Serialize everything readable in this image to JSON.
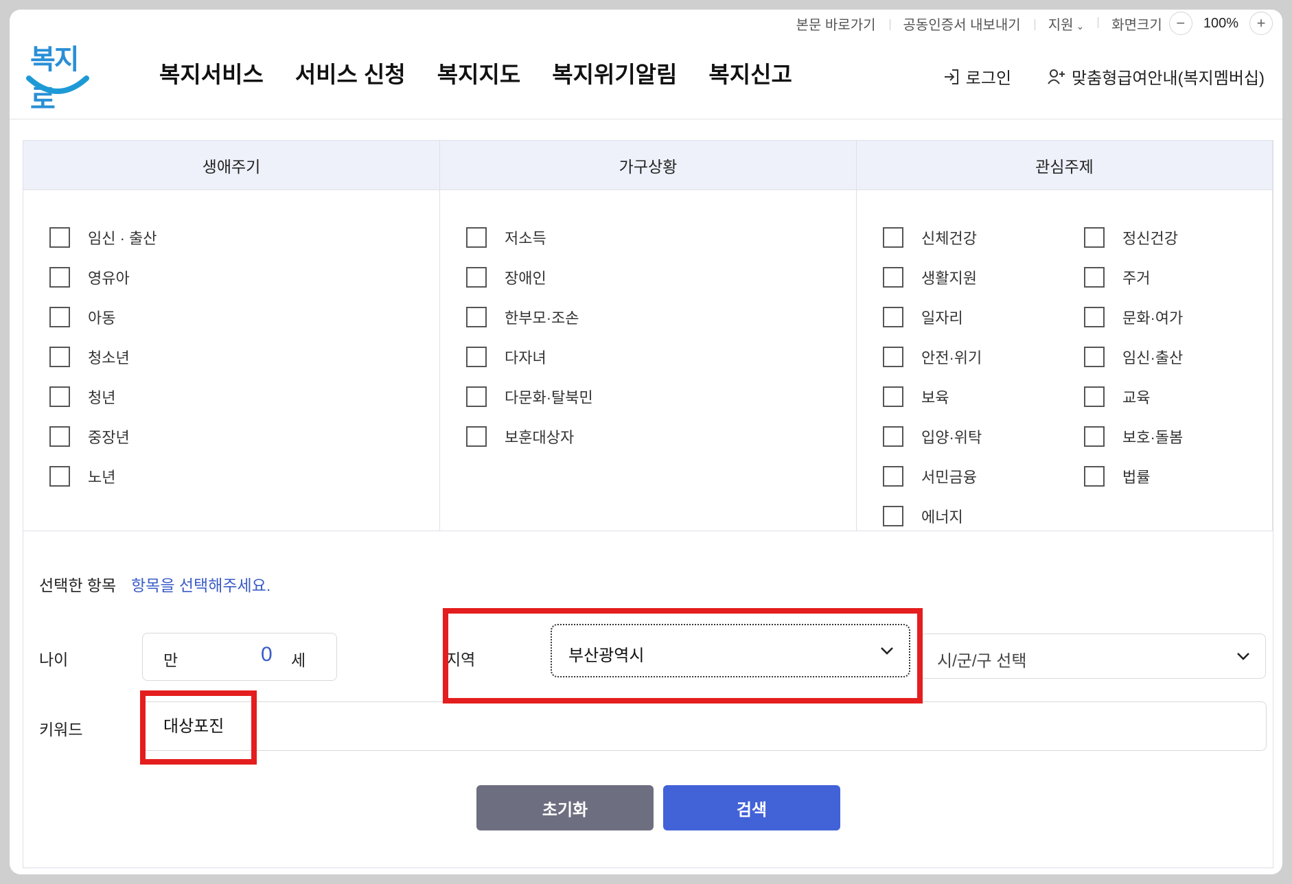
{
  "utility": {
    "skip": "본문 바로가기",
    "cert": "공동인증서 내보내기",
    "support": "지원",
    "screen_size": "화면크기",
    "zoom_value": "100%",
    "zoom_out": "−",
    "zoom_in": "+"
  },
  "logo": {
    "text": "복지로"
  },
  "nav": [
    "복지서비스",
    "서비스 신청",
    "복지지도",
    "복지위기알림",
    "복지신고"
  ],
  "header_right": {
    "login": "로그인",
    "membership": "맞춤형급여안내(복지멤버십)"
  },
  "categories": {
    "lifecycle": {
      "title": "생애주기",
      "items": [
        "임신 · 출산",
        "영유아",
        "아동",
        "청소년",
        "청년",
        "중장년",
        "노년"
      ]
    },
    "household": {
      "title": "가구상황",
      "items": [
        "저소득",
        "장애인",
        "한부모·조손",
        "다자녀",
        "다문화·탈북민",
        "보훈대상자"
      ]
    },
    "interest": {
      "title": "관심주제",
      "left": [
        "신체건강",
        "생활지원",
        "일자리",
        "안전·위기",
        "보육",
        "입양·위탁",
        "서민금융",
        "에너지"
      ],
      "right": [
        "정신건강",
        "주거",
        "문화·여가",
        "임신·출산",
        "교육",
        "보호·돌봄",
        "법률"
      ]
    }
  },
  "form": {
    "selected_label": "선택한 항목",
    "selected_hint": "항목을 선택해주세요.",
    "age_label": "나이",
    "age_prefix": "만",
    "age_value": "0",
    "age_suffix": "세",
    "region_label": "지역",
    "region_value": "부산광역시",
    "sigungu_value": "시/군/구 선택",
    "keyword_label": "키워드",
    "keyword_value": "대상포진"
  },
  "buttons": {
    "reset": "초기화",
    "search": "검색"
  },
  "colors": {
    "accent": "#4262d8",
    "highlight": "#e41e1e",
    "header_bg": "#eef1fa",
    "reset_bg": "#6d6f80"
  }
}
